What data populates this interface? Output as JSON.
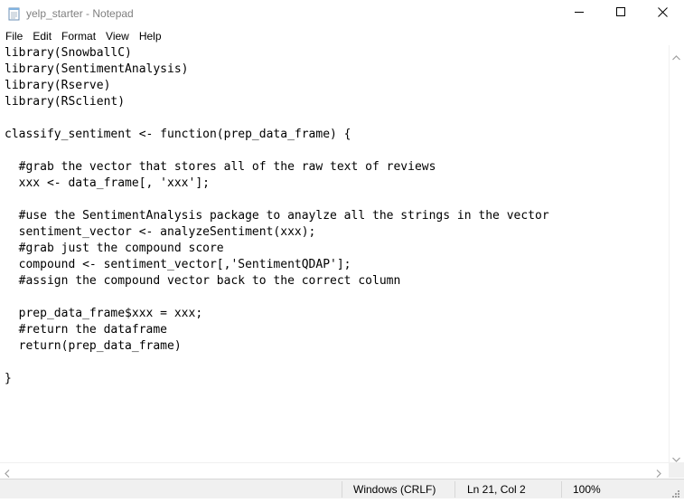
{
  "window": {
    "title": "yelp_starter - Notepad"
  },
  "menu": {
    "items": [
      "File",
      "Edit",
      "Format",
      "View",
      "Help"
    ]
  },
  "editor": {
    "lines": [
      "library(SnowballC)",
      "library(SentimentAnalysis)",
      "library(Rserve)",
      "library(RSclient)",
      "",
      "classify_sentiment <- function(prep_data_frame) {",
      "",
      "  #grab the vector that stores all of the raw text of reviews",
      "  xxx <- data_frame[, 'xxx'];",
      "",
      "  #use the SentimentAnalysis package to anaylze all the strings in the vector",
      "  sentiment_vector <- analyzeSentiment(xxx);",
      "  #grab just the compound score",
      "  compound <- sentiment_vector[,'SentimentQDAP'];",
      "  #assign the compound vector back to the correct column",
      "",
      "  prep_data_frame$xxx = xxx;",
      "  #return the dataframe",
      "  return(prep_data_frame)",
      "",
      "}"
    ]
  },
  "status": {
    "line_ending": "Windows (CRLF)",
    "cursor": "Ln 21, Col 2",
    "zoom": "100%"
  },
  "icons": {
    "app": "notepad-icon",
    "minimize": "minimize-icon",
    "maximize": "maximize-icon",
    "close": "close-icon"
  }
}
